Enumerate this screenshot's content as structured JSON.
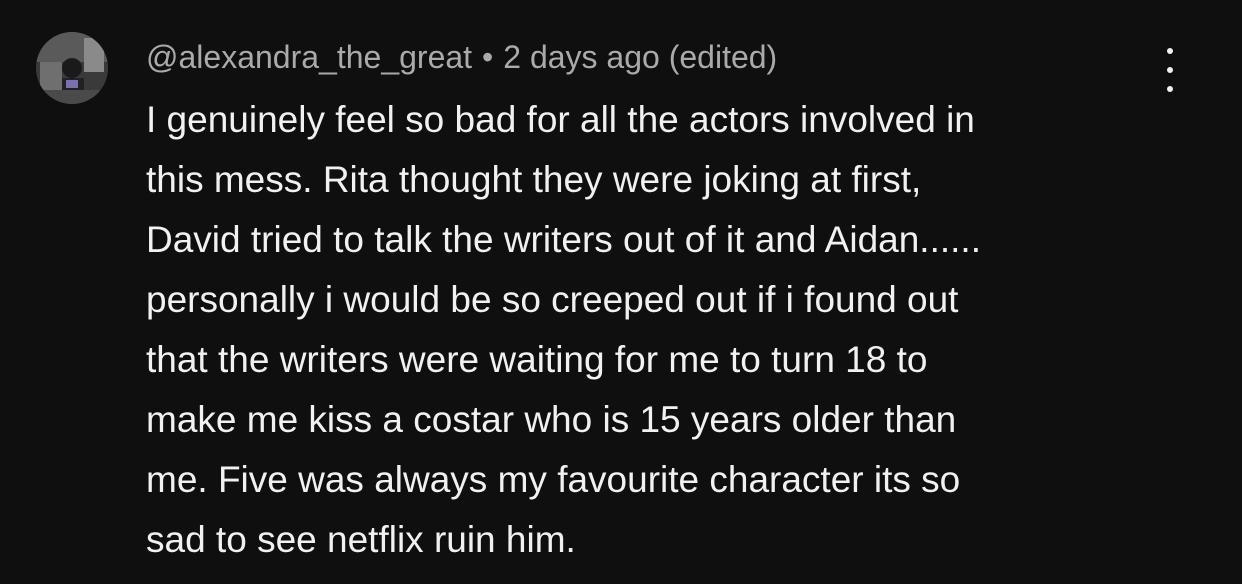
{
  "comment": {
    "author": "@alexandra_the_great",
    "separator": "•",
    "timestamp": "2 days ago (edited)",
    "text_lines": [
      "I genuinely feel so bad for all the actors involved in",
      "this mess. Rita thought they were joking at first,",
      "David tried to talk the writers out of it and Aidan......",
      "personally i would be so creeped out if i found out",
      "that the writers were waiting for me to turn 18 to",
      "make me kiss a costar who is 15 years older than",
      "me. Five was always my favourite character its so",
      "sad to see netflix ruin him."
    ],
    "avatar_icon": "avatar-photo",
    "menu_icon": "more-vertical-icon"
  },
  "colors": {
    "background": "#0f0f0f",
    "text": "#f1f1f1",
    "meta": "#aaaaaa"
  }
}
